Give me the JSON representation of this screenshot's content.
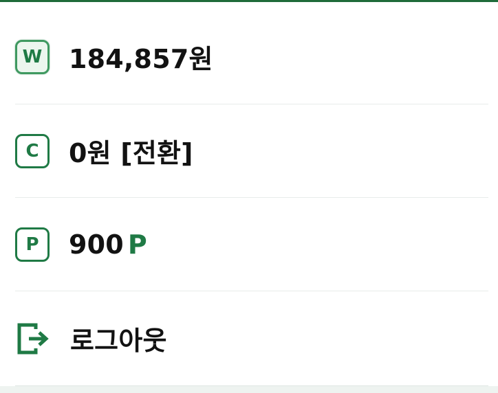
{
  "menu": {
    "wallet": {
      "icon_text": "W",
      "icon": "wallet-w-icon",
      "amount": "184,857원"
    },
    "cash": {
      "icon_text": "C",
      "icon": "cash-c-icon",
      "amount": "0원",
      "action": "[전환]"
    },
    "points": {
      "icon_text": "P",
      "icon": "point-p-icon",
      "amount": "900",
      "unit": "P"
    },
    "logout": {
      "icon": "logout-icon",
      "label": "로그아웃"
    }
  },
  "colors": {
    "accent": "#1f7a45",
    "top_line": "#1f6b3a",
    "divider": "#e8ecea",
    "text": "#121212"
  }
}
